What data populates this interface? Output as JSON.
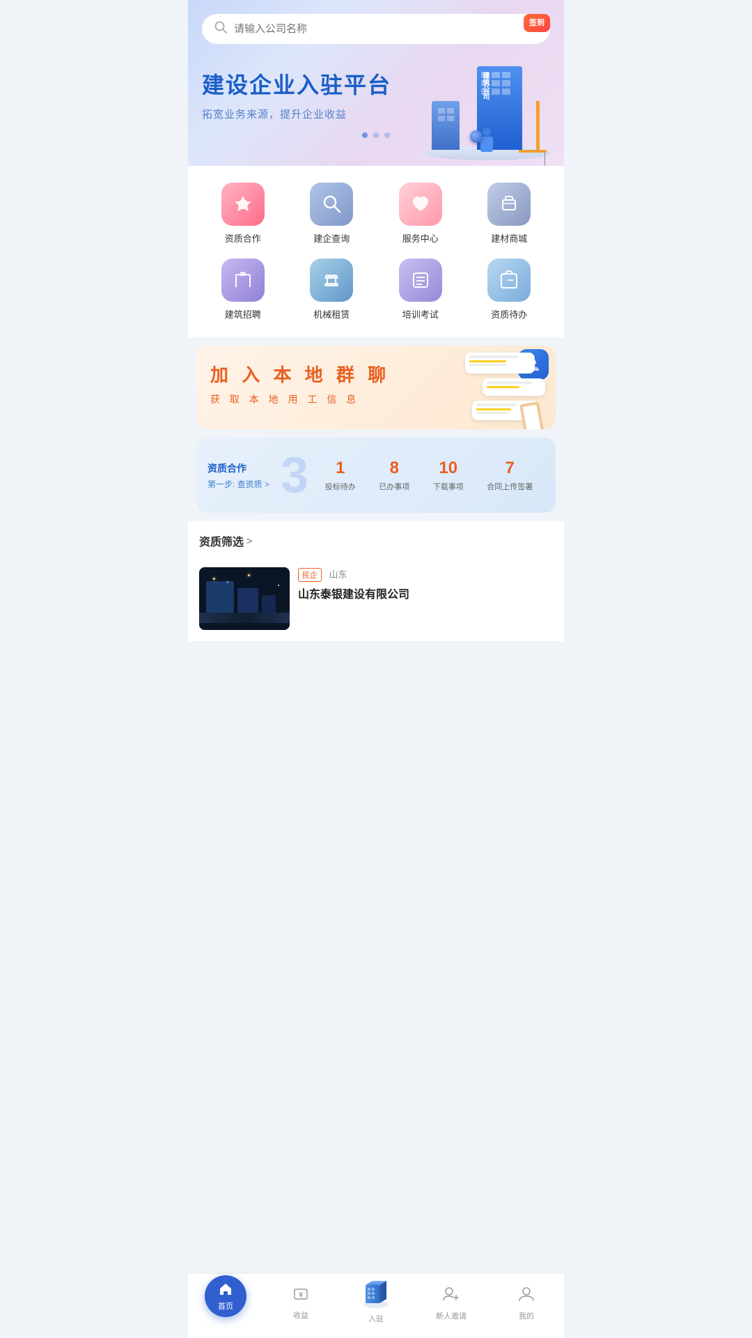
{
  "search": {
    "placeholder": "请输入公司名称"
  },
  "sign_in": {
    "label": "签到"
  },
  "hero": {
    "title": "建设企业入驻平台",
    "subtitle": "拓宽业务来源，提升企业收益",
    "building_label": "建\n筑\n公\n司"
  },
  "banner_dots": [
    {
      "active": true
    },
    {
      "active": false
    },
    {
      "active": false
    }
  ],
  "menu_icons": [
    {
      "id": "qualification",
      "label": "资质合作",
      "icon": "⭐",
      "color": "pink-red"
    },
    {
      "id": "company-search",
      "label": "建企查询",
      "icon": "🔍",
      "color": "blue-gray"
    },
    {
      "id": "service-center",
      "label": "服务中心",
      "icon": "❤️",
      "color": "pink-soft"
    },
    {
      "id": "material-mall",
      "label": "建材商城",
      "icon": "👜",
      "color": "slate-blue"
    },
    {
      "id": "recruit",
      "label": "建筑招聘",
      "icon": "🎓",
      "color": "purple-blue"
    },
    {
      "id": "machinery",
      "label": "机械租赁",
      "icon": "🏷️",
      "color": "teal-blue"
    },
    {
      "id": "training",
      "label": "培训考试",
      "icon": "📋",
      "color": "lavender"
    },
    {
      "id": "qualification-pending",
      "label": "资质待办",
      "icon": "✉️",
      "color": "light-blue"
    }
  ],
  "chat_banner": {
    "title": "加 入 本 地 群 聊",
    "subtitle": "获 取 本 地 用 工 信 息"
  },
  "stats": {
    "section_title": "资质合作",
    "section_link": "第一步: 查资质 >",
    "big_number": "3",
    "items": [
      {
        "num": "1",
        "label": "投标待办"
      },
      {
        "num": "8",
        "label": "已办事项"
      },
      {
        "num": "10",
        "label": "下载事项"
      },
      {
        "num": "7",
        "label": "合同上传签署"
      }
    ]
  },
  "filter": {
    "title": "资质筛选",
    "chevron": ">"
  },
  "company": {
    "tag": "民企",
    "name": "山东泰银建设有限公司"
  },
  "bottom_nav": [
    {
      "id": "home",
      "label": "首页",
      "icon": "↓",
      "active": true,
      "is_home": true
    },
    {
      "id": "income",
      "label": "收益",
      "icon": "¥",
      "active": false
    },
    {
      "id": "join",
      "label": "入驻",
      "icon": "building",
      "active": false,
      "is_center": true
    },
    {
      "id": "invite",
      "label": "新人邀请",
      "icon": "person-add",
      "active": false
    },
    {
      "id": "mine",
      "label": "我的",
      "icon": "person",
      "active": false
    }
  ]
}
